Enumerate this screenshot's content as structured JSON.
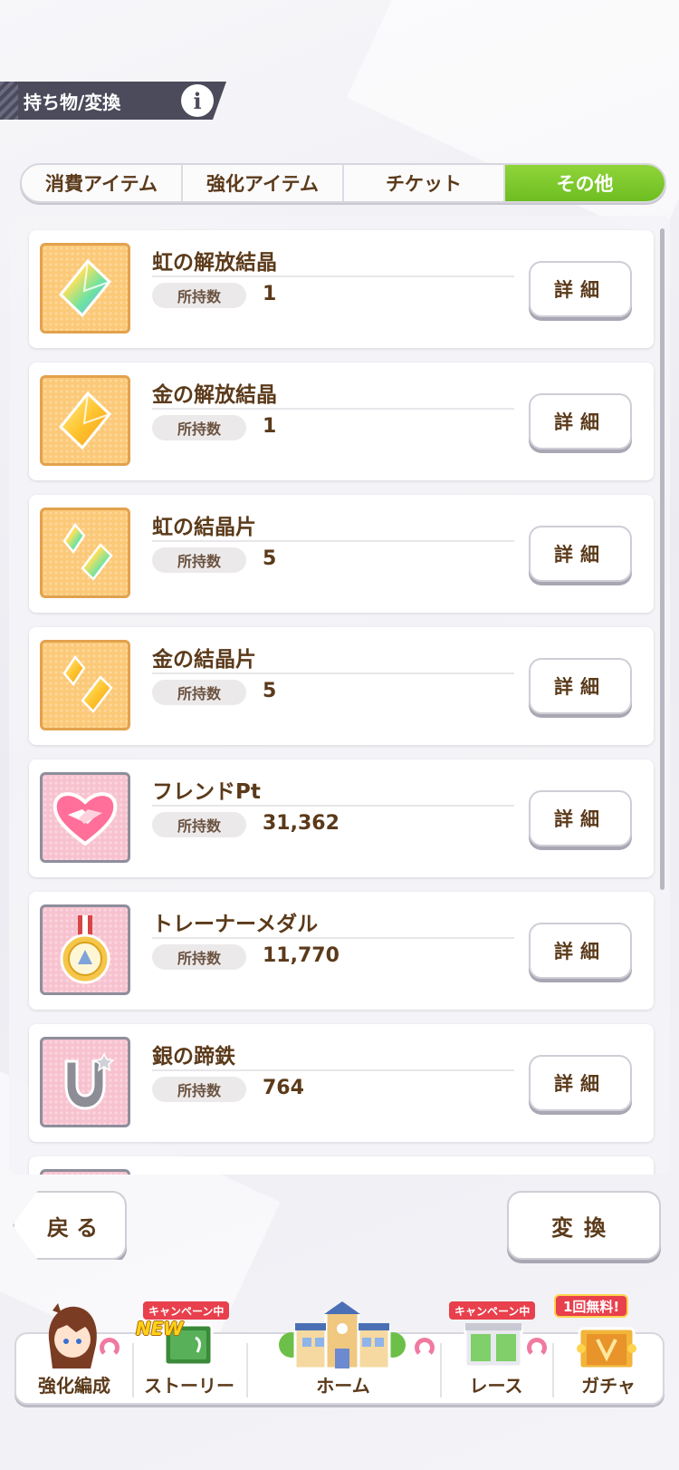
{
  "header": {
    "title": "持ち物/変換",
    "info_label": "i"
  },
  "tabs": [
    {
      "label": "消費アイテム",
      "active": false
    },
    {
      "label": "強化アイテム",
      "active": false
    },
    {
      "label": "チケット",
      "active": false
    },
    {
      "label": "その他",
      "active": true
    }
  ],
  "items": [
    {
      "name": "虹の解放結晶",
      "count_label": "所持数",
      "count": "1",
      "icon": "rainbow-crystal-icon"
    },
    {
      "name": "金の解放結晶",
      "count_label": "所持数",
      "count": "1",
      "icon": "gold-crystal-icon"
    },
    {
      "name": "虹の結晶片",
      "count_label": "所持数",
      "count": "5",
      "icon": "rainbow-shard-icon"
    },
    {
      "name": "金の結晶片",
      "count_label": "所持数",
      "count": "5",
      "icon": "gold-shard-icon"
    },
    {
      "name": "フレンドPt",
      "count_label": "所持数",
      "count": "31,362",
      "icon": "handshake-heart-icon"
    },
    {
      "name": "トレーナーメダル",
      "count_label": "所持数",
      "count": "11,770",
      "icon": "trainer-medal-icon"
    },
    {
      "name": "銀の蹄鉄",
      "count_label": "所持数",
      "count": "764",
      "icon": "silver-horseshoe-icon"
    }
  ],
  "detail_label": "詳細",
  "buttons": {
    "back": "戻る",
    "convert": "変換"
  },
  "nav": [
    {
      "label": "強化編成"
    },
    {
      "label": "ストーリー",
      "badge": "キャンペーン中",
      "new": "NEW"
    },
    {
      "label": "ホーム"
    },
    {
      "label": "レース",
      "badge": "キャンペーン中"
    },
    {
      "label": "ガチャ",
      "badge": "1回無料!"
    }
  ],
  "colors": {
    "tab_active": "#6ebe21",
    "text_brown": "#5b3a1a",
    "campaign_red": "#e8404d"
  }
}
